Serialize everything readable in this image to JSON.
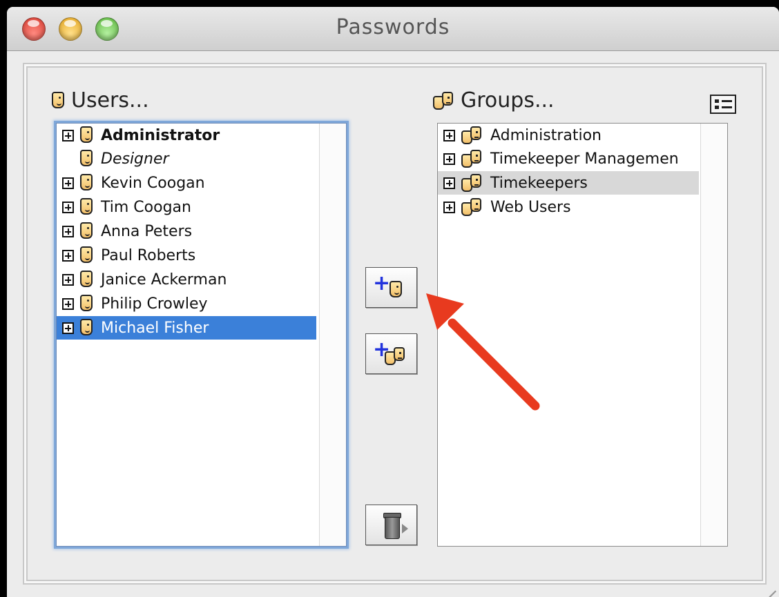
{
  "window": {
    "title": "Passwords"
  },
  "users": {
    "label": "Users...",
    "items": [
      {
        "name": "Administrator",
        "style": "bold",
        "expandable": true
      },
      {
        "name": "Designer",
        "style": "italic",
        "expandable": false
      },
      {
        "name": "Kevin Coogan",
        "style": "normal",
        "expandable": true
      },
      {
        "name": "Tim Coogan",
        "style": "normal",
        "expandable": true
      },
      {
        "name": "Anna Peters",
        "style": "normal",
        "expandable": true
      },
      {
        "name": "Paul Roberts",
        "style": "normal",
        "expandable": true
      },
      {
        "name": "Janice Ackerman",
        "style": "normal",
        "expandable": true
      },
      {
        "name": "Philip Crowley",
        "style": "normal",
        "expandable": true
      },
      {
        "name": "Michael Fisher",
        "style": "normal",
        "expandable": true,
        "selected": true
      }
    ]
  },
  "groups": {
    "label": "Groups...",
    "items": [
      {
        "name": "Administration"
      },
      {
        "name": "Timekeeper Managemen"
      },
      {
        "name": "Timekeepers",
        "selected": true
      },
      {
        "name": "Web Users"
      }
    ]
  },
  "buttons": {
    "add_user_icon": "add-user-icon",
    "add_group_icon": "add-group-icon",
    "delete_icon": "trash-icon"
  },
  "colors": {
    "selection": "#3b80d9",
    "group_selection": "#d8d8d8",
    "annotation_arrow": "#e83a1f"
  }
}
